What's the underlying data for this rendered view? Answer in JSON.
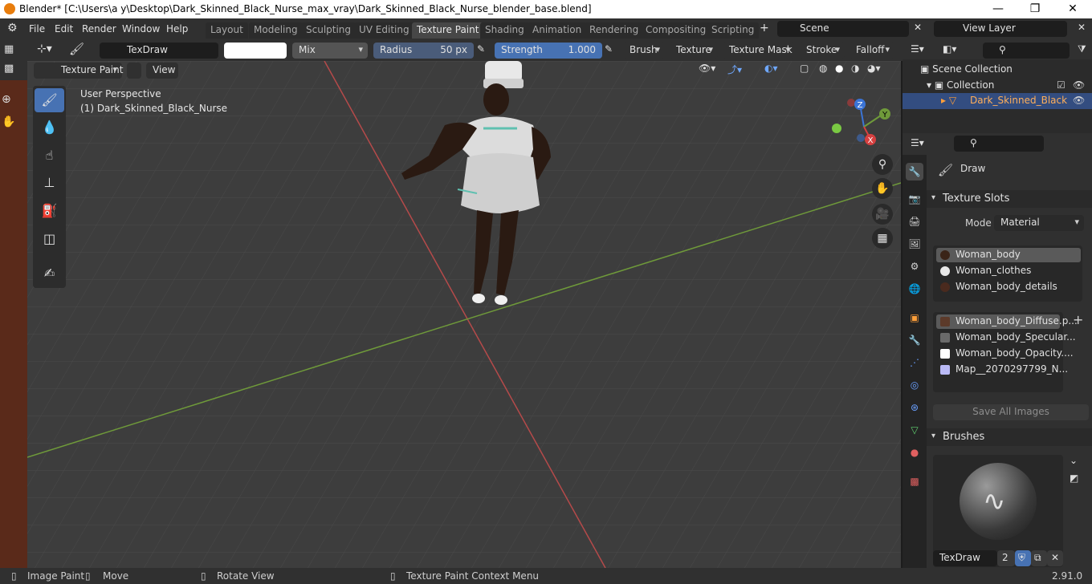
{
  "titlebar": {
    "title": "Blender* [C:\\Users\\a y\\Desktop\\Dark_Skinned_Black_Nurse_max_vray\\Dark_Skinned_Black_Nurse_blender_base.blend]",
    "minimize": "—",
    "maximize": "❐",
    "close": "✕"
  },
  "menu": {
    "file": "File",
    "edit": "Edit",
    "render": "Render",
    "window": "Window",
    "help": "Help"
  },
  "tabs": [
    "Layout",
    "Modeling",
    "Sculpting",
    "UV Editing",
    "Texture Paint",
    "Shading",
    "Animation",
    "Rendering",
    "Compositing",
    "Scripting"
  ],
  "active_tab": "Texture Paint",
  "scene": {
    "name": "Scene",
    "view_layer": "View Layer"
  },
  "tool_header": {
    "brush_name": "TexDraw",
    "blend": "Mix",
    "radius_label": "Radius",
    "radius_value": "50 px",
    "strength_label": "Strength",
    "strength_value": "1.000",
    "brush_menu": "Brush",
    "texture_menu": "Texture",
    "texture_mask_menu": "Texture Mask",
    "stroke_menu": "Stroke",
    "falloff_menu": "Falloff"
  },
  "mode_header": {
    "mode": "Texture Paint",
    "view": "View"
  },
  "viewport": {
    "perspective": "User Perspective",
    "object": "(1) Dark_Skinned_Black_Nurse",
    "gizmo_z": "Z",
    "gizmo_y": "Y",
    "gizmo_x": "X"
  },
  "outliner": {
    "scene_collection": "Scene Collection",
    "collection": "Collection",
    "object": "Dark_Skinned_Black"
  },
  "properties": {
    "brush_title": "Draw",
    "texture_slots_title": "Texture Slots",
    "mode_label": "Mode",
    "mode_value": "Material",
    "materials": [
      {
        "name": "Woman_body",
        "color": "#3a2418"
      },
      {
        "name": "Woman_clothes",
        "color": "#e8e8e8"
      },
      {
        "name": "Woman_body_details",
        "color": "#4a2a1e"
      }
    ],
    "images": [
      {
        "name": "Woman_body_Diffuse.p...",
        "color": "#5c3a2a"
      },
      {
        "name": "Woman_body_Specular...",
        "color": "#6a6a6a"
      },
      {
        "name": "Woman_body_Opacity....",
        "color": "#ffffff"
      },
      {
        "name": "Map__2070297799_N...",
        "color": "#b9b9f5"
      }
    ],
    "save_all": "Save All Images",
    "brushes_title": "Brushes",
    "brush_name": "TexDraw",
    "brush_users": "2"
  },
  "status": {
    "image_paint": "Image Paint",
    "move": "Move",
    "rotate": "Rotate View",
    "context": "Texture Paint Context Menu",
    "version": "2.91.0"
  }
}
